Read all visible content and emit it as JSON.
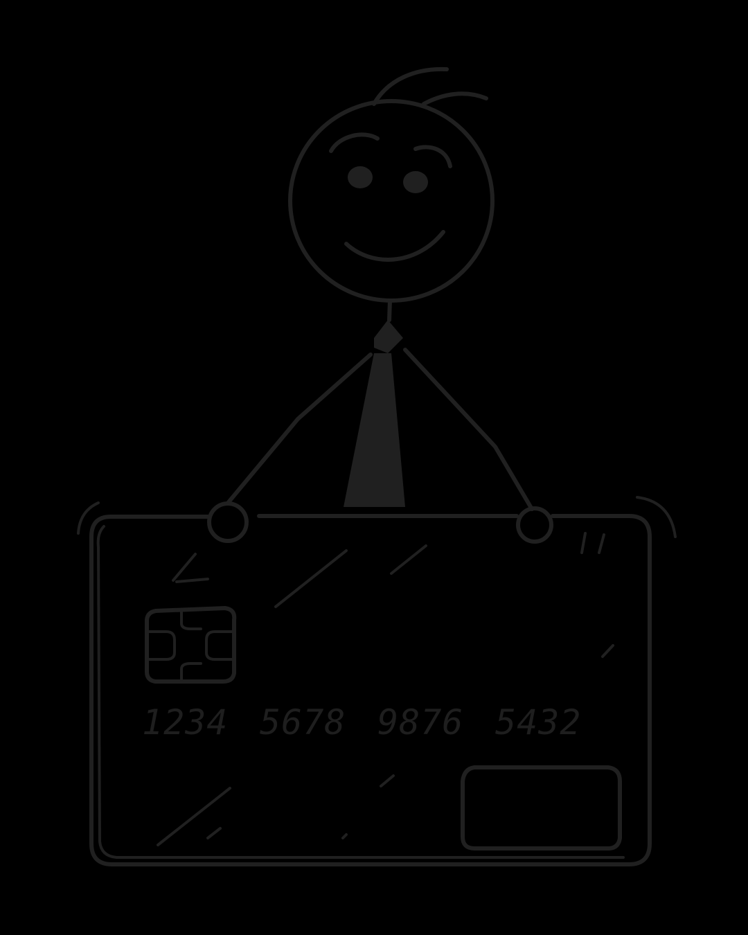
{
  "illustration": {
    "background": "#000000",
    "ink": "#202020",
    "card": {
      "number_groups": [
        "1234",
        "5678",
        "9876",
        "5432"
      ]
    }
  }
}
